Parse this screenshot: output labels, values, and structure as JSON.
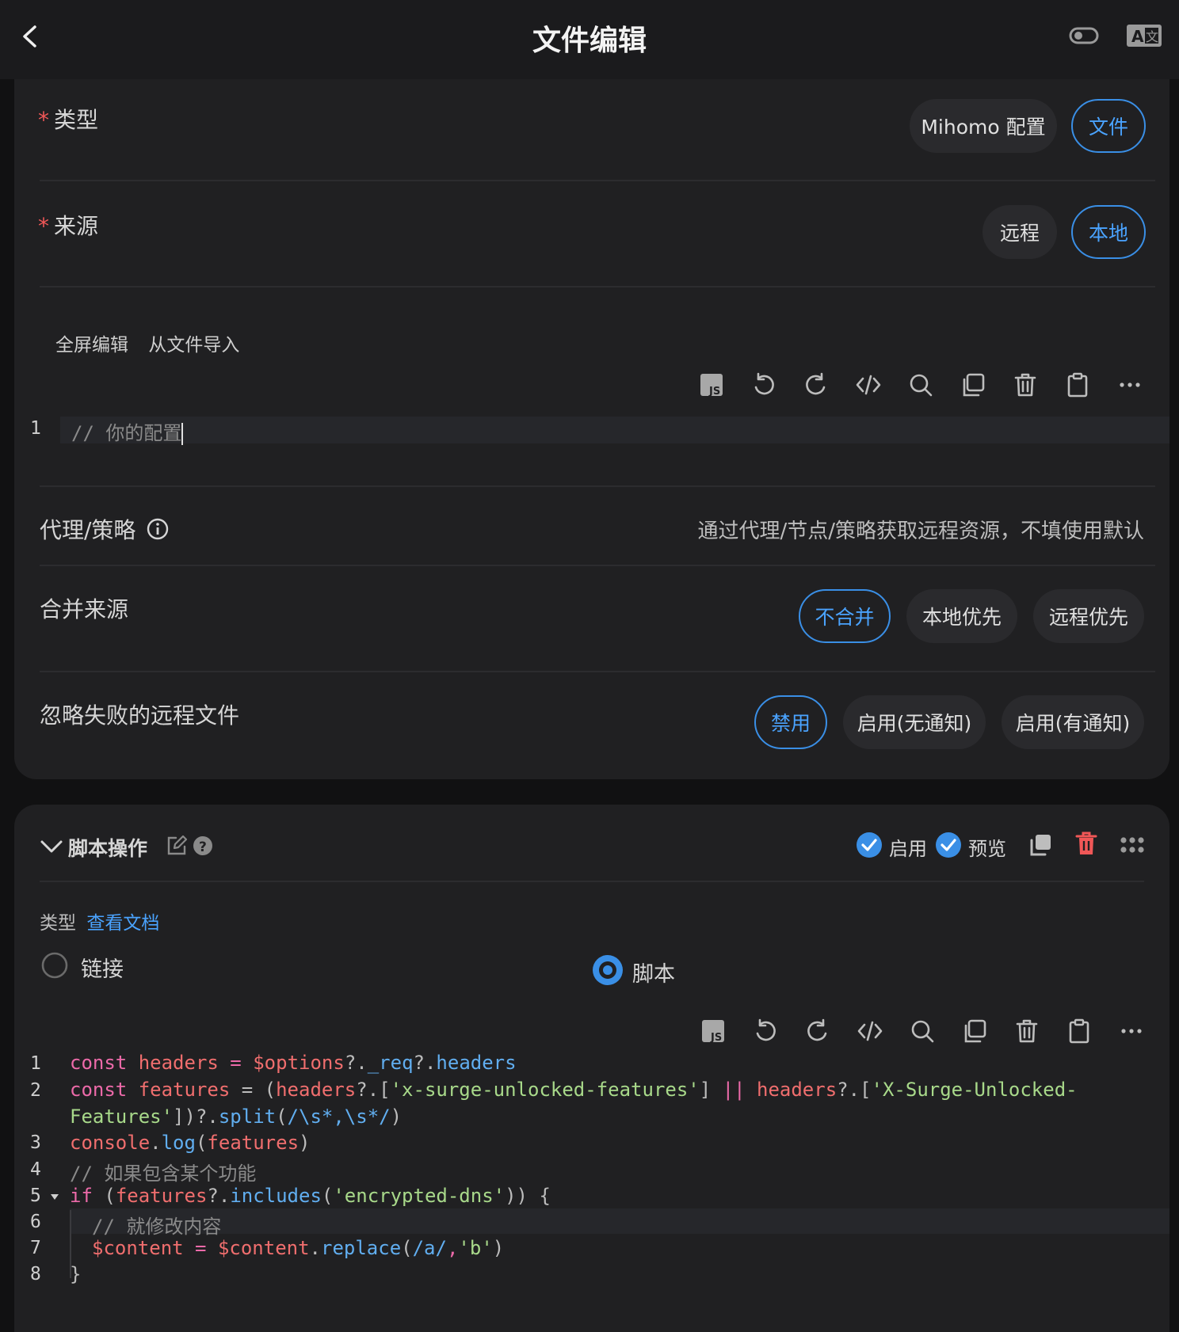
{
  "header": {
    "title": "文件编辑"
  },
  "type_field": {
    "label": "类型",
    "options": [
      "Mihomo 配置",
      "文件"
    ],
    "selected": "文件"
  },
  "source_field": {
    "label": "来源",
    "options": [
      "远程",
      "本地"
    ],
    "selected": "本地"
  },
  "editor_links": {
    "fullscreen": "全屏编辑",
    "import": "从文件导入"
  },
  "editor1": {
    "lines": [
      {
        "num": "1",
        "text": "// 你的配置"
      }
    ]
  },
  "proxy_field": {
    "label": "代理/策略",
    "placeholder": "通过代理/节点/策略获取远程资源，不填使用默认"
  },
  "merge_field": {
    "label": "合并来源",
    "options": [
      "不合并",
      "本地优先",
      "远程优先"
    ],
    "selected": "不合并"
  },
  "ignore_field": {
    "label": "忽略失败的远程文件",
    "options": [
      "禁用",
      "启用(无通知)",
      "启用(有通知)"
    ],
    "selected": "禁用"
  },
  "script_card": {
    "title": "脚本操作",
    "enable_label": "启用",
    "preview_label": "预览",
    "type_label": "类型",
    "doc_link": "查看文档",
    "radio_link": "链接",
    "radio_script": "脚本"
  },
  "editor2": {
    "line_numbers": [
      "1",
      "2",
      "",
      "3",
      "4",
      "5",
      "6",
      "7",
      "8"
    ],
    "l1": {
      "a": "const",
      "b": "headers",
      "c": " = ",
      "d": "$options",
      "e": "?.",
      "f": "_req",
      "g": "?.",
      "h": "headers"
    },
    "l2": {
      "a": "const",
      "b": "features",
      "c": " = (",
      "d": "headers",
      "e": "?.[",
      "f": "'x-surge-unlocked-features'",
      "g": "] ",
      "h": "||",
      "i": " headers",
      "j": "?.[",
      "k": "'X-Surge-Unlocked-"
    },
    "l2b": {
      "a": "Features'",
      "b": "])?.",
      "c": "split",
      "d": "(",
      "e": "/\\s*,\\s*/",
      "f": ")"
    },
    "l3": {
      "a": "console",
      "b": ".",
      "c": "log",
      "d": "(",
      "e": "features",
      "f": ")"
    },
    "l4": {
      "a": "// 如果包含某个功能"
    },
    "l5": {
      "a": "if",
      "b": " (",
      "c": "features",
      "d": "?.",
      "e": "includes",
      "f": "(",
      "g": "'encrypted-dns'",
      "h": ")) {"
    },
    "l6": {
      "a": "// 就修改内容"
    },
    "l7": {
      "a": "$content",
      "b": " = ",
      "c": "$content",
      "d": ".",
      "e": "replace",
      "f": "(",
      "g": "/a/",
      "h": ",",
      "i": "'b'",
      "j": ")"
    },
    "l8": {
      "a": "}"
    }
  },
  "colors": {
    "accent": "#3a8fe6",
    "danger": "#f05757",
    "background": "#202022"
  }
}
